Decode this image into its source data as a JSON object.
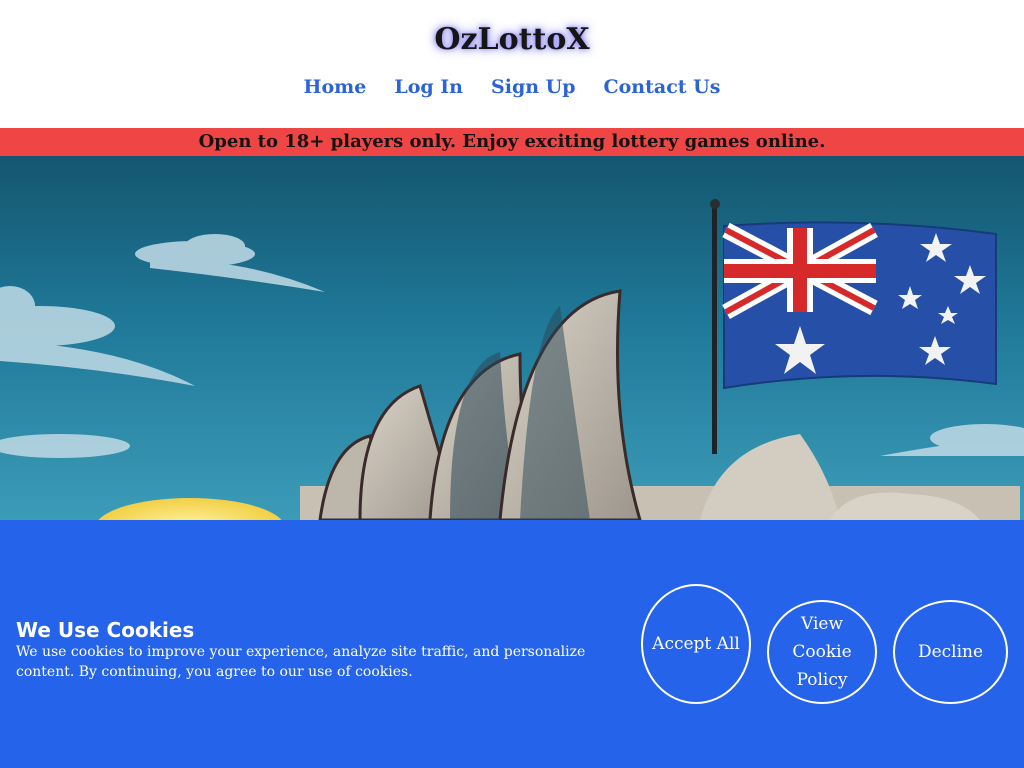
{
  "site": {
    "logo": "OzLottoX"
  },
  "nav": {
    "items": [
      "Home",
      "Log In",
      "Sign Up",
      "Contact Us"
    ]
  },
  "banner": {
    "text": "Open to 18+ players only. Enjoy exciting lottery games online."
  },
  "hero": {
    "image": "sydney-opera-house-australian-flag-illustration"
  },
  "cookie": {
    "title": "We Use Cookies",
    "text": "We use cookies to improve your experience, analyze site traffic, and personalize content. By continuing, you agree to our use of cookies.",
    "accept": "Accept All",
    "view_policy": "View Cookie Policy",
    "decline": "Decline"
  },
  "colors": {
    "nav_link": "#2c63d6",
    "banner_bg": "#ef4545",
    "cookie_bg": "#2563eb",
    "sky": "#1d6f8e"
  }
}
